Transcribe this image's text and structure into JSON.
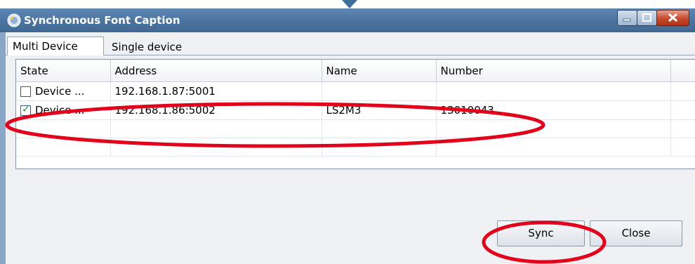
{
  "window": {
    "title": "Synchronous Font Caption",
    "title_bar_color": "#4a739f"
  },
  "tabs": [
    {
      "label": "Multi Device",
      "active": true
    },
    {
      "label": "Single device",
      "active": false
    }
  ],
  "table": {
    "columns": [
      "State",
      "Address",
      "Name",
      "Number"
    ],
    "rows": [
      {
        "checked": false,
        "state": "Device ...",
        "address": "192.168.1.87:5001",
        "name": "",
        "number": ""
      },
      {
        "checked": true,
        "state": "Device ...",
        "address": "192.168.1.86:5002",
        "name": "LS2M3",
        "number": "13010043"
      }
    ]
  },
  "buttons": {
    "sync": "Sync",
    "close": "Close"
  },
  "annotation_color": "#e2001a"
}
